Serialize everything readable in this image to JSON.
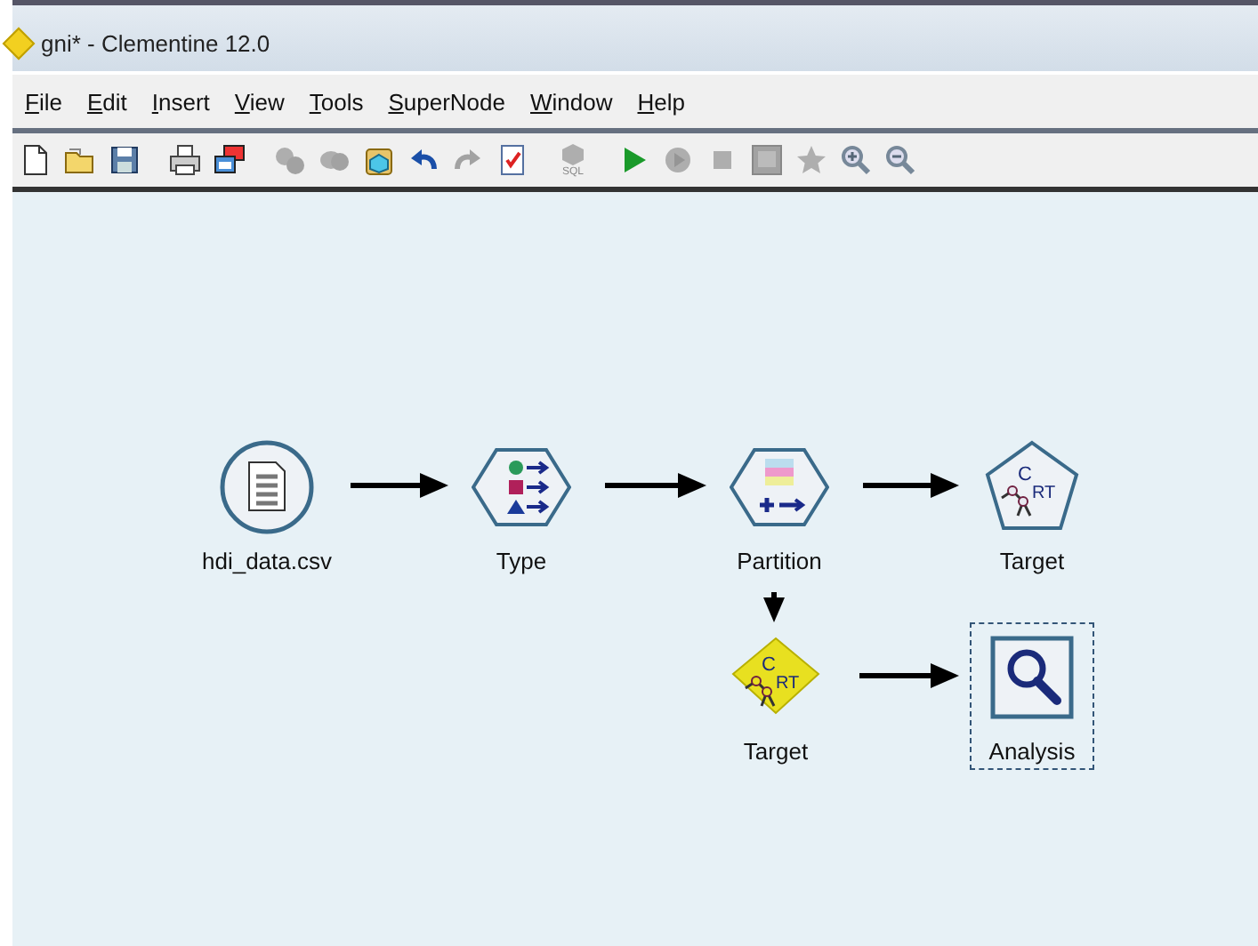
{
  "window": {
    "title": "gni* - Clementine 12.0"
  },
  "menu": [
    "File",
    "Edit",
    "Insert",
    "View",
    "Tools",
    "SuperNode",
    "Window",
    "Help"
  ],
  "toolbar": [
    {
      "kind": "new",
      "disabled": false
    },
    {
      "kind": "open",
      "disabled": false
    },
    {
      "kind": "save",
      "disabled": false
    },
    {
      "kind": "print",
      "disabled": false
    },
    {
      "kind": "windows",
      "disabled": false
    },
    {
      "kind": "cut",
      "disabled": true
    },
    {
      "kind": "copy",
      "disabled": true
    },
    {
      "kind": "paste",
      "disabled": false
    },
    {
      "kind": "undo",
      "disabled": false
    },
    {
      "kind": "redo",
      "disabled": true
    },
    {
      "kind": "annotate",
      "disabled": false
    },
    {
      "kind": "sql",
      "disabled": true,
      "label": "SQL"
    },
    {
      "kind": "run",
      "disabled": false
    },
    {
      "kind": "run-selection",
      "disabled": true
    },
    {
      "kind": "stop",
      "disabled": true
    },
    {
      "kind": "panel",
      "disabled": true
    },
    {
      "kind": "star",
      "disabled": true
    },
    {
      "kind": "zoom-in",
      "disabled": false
    },
    {
      "kind": "zoom-out",
      "disabled": false
    }
  ],
  "nodes": [
    {
      "kind": "source",
      "label": "hdi_data.csv",
      "selected": false
    },
    {
      "kind": "type",
      "label": "Type",
      "selected": false
    },
    {
      "kind": "partition",
      "label": "Partition",
      "selected": false
    },
    {
      "kind": "model",
      "label": "Target",
      "selected": false,
      "icon_text": [
        "C",
        "RT"
      ]
    },
    {
      "kind": "nugget",
      "label": "Target",
      "selected": false,
      "icon_text": [
        "C",
        "RT"
      ]
    },
    {
      "kind": "output",
      "label": "Analysis",
      "selected": true
    }
  ]
}
